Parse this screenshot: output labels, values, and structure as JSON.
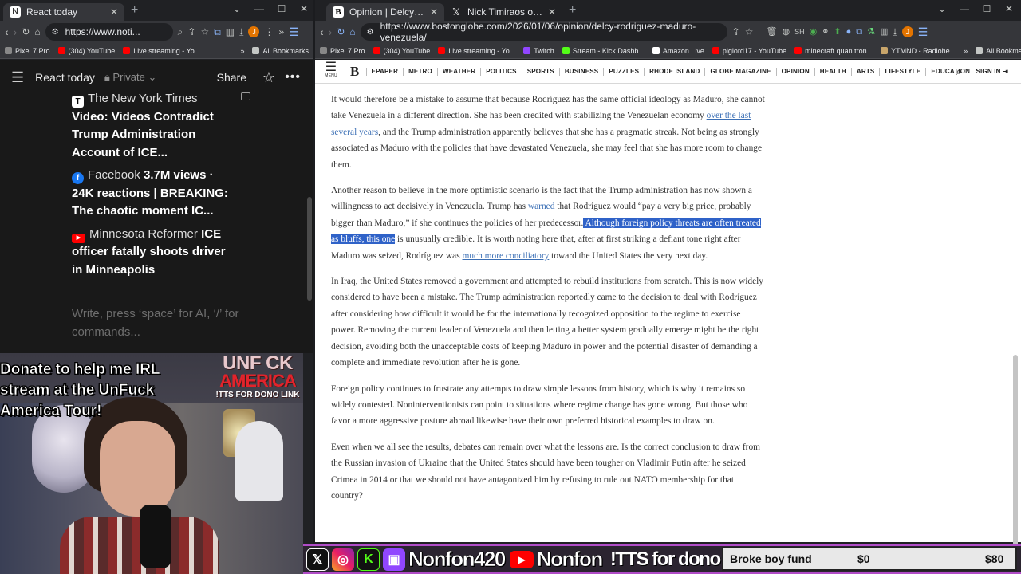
{
  "left_window": {
    "tab_title": "React today",
    "url": "https://www.noti...",
    "bookmarks": [
      "Pixel 7 Pro",
      "(304) YouTube",
      "Live streaming - Yo..."
    ],
    "bookmarks_more": "»",
    "all_bookmarks": "All Bookmarks",
    "page": {
      "title": "React today",
      "privacy": "Private",
      "share": "Share",
      "items": [
        {
          "source": "The New York Times",
          "source_icon": "nyt-icon",
          "headline": "Video: Videos Contradict Trump Administration Account of ICE..."
        },
        {
          "source": "Facebook",
          "source_icon": "facebook-icon",
          "headline": "3.7M views · 24K reactions | BREAKING: The chaotic moment IC..."
        },
        {
          "source": "Minnesota Reformer",
          "source_icon": "youtube-icon",
          "headline": "ICE officer fatally shoots driver in Minneapolis"
        }
      ],
      "input_placeholder": "Write, press ‘space’ for AI, ‘/’ for commands..."
    }
  },
  "stream_overlay": {
    "donate_text": "Donate to help me  IRL stream at the UnFuck America Tour!",
    "logo_line1": "UNF CK",
    "logo_line2": "AMERICA",
    "logo_line3": "!TTS FOR DONO LINK",
    "handle_1": "Nonfon420",
    "handle_2": "Nonfon",
    "tts_text": "!TTS for dono link",
    "fund_name": "Broke boy fund",
    "fund_amount": "$0",
    "fund_goal": "$80",
    "colors": {
      "border": "#b04cc7",
      "twitch": "#9146ff",
      "kick": "#53fc18",
      "youtube": "#ff0000"
    }
  },
  "right_window": {
    "tabs": [
      {
        "title": "Opinion | Delcy Rodríguez and",
        "active": true
      },
      {
        "title": "Nick Timiraos on X: \"NEW: Tru",
        "active": false
      }
    ],
    "url": "https://www.bostonglobe.com/2026/01/06/opinion/delcy-rodriguez-maduro-venezuela/",
    "bookmarks": [
      "Pixel 7 Pro",
      "(304) YouTube",
      "Live streaming - Yo...",
      "Twitch",
      "Stream - Kick Dashb...",
      "Amazon Live",
      "piglord17 - YouTube",
      "minecraft quan tron...",
      "YTMND - Radiohe..."
    ],
    "bookmarks_more": "»",
    "all_bookmarks": "All Bookmarks",
    "site_nav": {
      "menu_label": "MENU",
      "sections": [
        "EPAPER",
        "METRO",
        "WEATHER",
        "POLITICS",
        "SPORTS",
        "BUSINESS",
        "PUZZLES",
        "RHODE ISLAND",
        "GLOBE MAGAZINE",
        "OPINION",
        "HEALTH",
        "ARTS",
        "LIFESTYLE",
        "EDUCATION"
      ],
      "sign_in": "SIGN IN"
    },
    "article": {
      "p1_a": "It would therefore be a mistake to assume that because Rodríguez has the same official ideology as Maduro, she cannot take Venezuela in a different direction. She has been credited with stabilizing the Venezuelan economy ",
      "p1_link": "over the last several years",
      "p1_b": ", and the Trump administration apparently believes that she has a pragmatic streak. Not being as strongly associated as Maduro with the policies that have devastated Venezuela, she may feel that she has more room to change them.",
      "p2_a": "Another reason to believe in the more optimistic scenario is the fact that the Trump administration has now shown a willingness to act decisively in Venezuela. Trump has ",
      "p2_link1": "warned",
      "p2_b": " that Rodríguez would “pay a very big price, probably bigger than Maduro,” if she continues the policies of her predecessor.",
      "p2_highlight": " Although foreign policy threats are often treated as bluffs, this one",
      "p2_c": " is unusually credible. It is worth noting here that, after at first striking a defiant tone right after Maduro was seized, Rodríguez was ",
      "p2_link2": "much more conciliatory",
      "p2_d": " toward the United States the very next day.",
      "p3": "In Iraq, the United States removed a government and attempted to rebuild institutions from scratch. This is now widely considered to have been a mistake. The Trump administration reportedly came to the decision to deal with Rodríguez after considering how difficult it would be for the internationally recognized opposition to the regime to exercise power. Removing the current leader of Venezuela and then letting a better system gradually emerge might be the right decision, avoiding both the unacceptable costs of keeping Maduro in power and the potential disaster of demanding a complete and immediate revolution after he is gone.",
      "p4": "Foreign policy continues to frustrate any attempts to draw simple lessons from history, which is why it remains so widely contested. Noninterventionists can point to situations where regime change has gone wrong. But those who favor a more aggressive posture abroad likewise have their own preferred historical examples to draw on.",
      "p5": "Even when we all see the results, debates can remain over what the lessons are. Is the correct conclusion to draw from the Russian invasion of Ukraine that the United States should have been tougher on Vladimir Putin after he seized Crimea in 2014 or that we should not have antagonized him by refusing to rule out NATO membership for that country?"
    }
  }
}
